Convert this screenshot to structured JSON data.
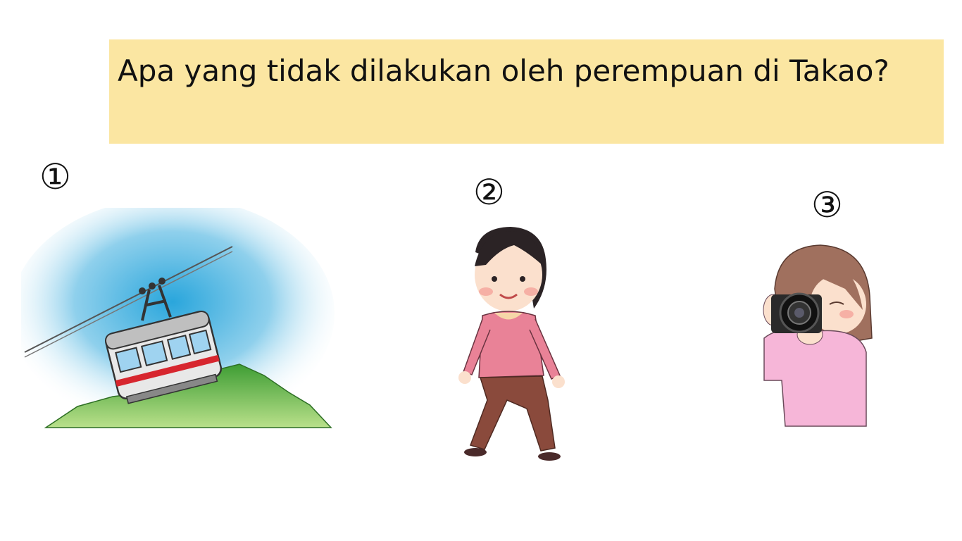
{
  "question": {
    "text": "Apa yang tidak dilakukan oleh perempuan di Takao?"
  },
  "options": [
    {
      "number": "①",
      "icon": "cable-car-icon"
    },
    {
      "number": "②",
      "icon": "walking-woman-icon"
    },
    {
      "number": "③",
      "icon": "photographer-icon"
    }
  ],
  "colors": {
    "question_bg": "#fbe6a2",
    "sky": "#4fb8e2",
    "hill": "#4aa83e",
    "cable_car_stripe": "#d7262e",
    "sweater": "#e98297",
    "pants": "#8a4a3c",
    "pink_shirt": "#f6b6d8"
  }
}
